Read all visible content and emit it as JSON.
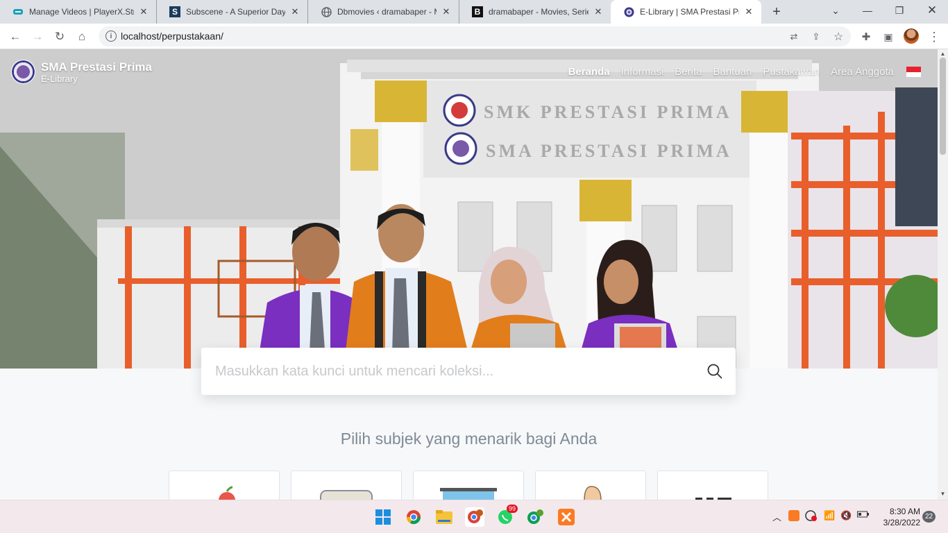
{
  "browser": {
    "tabs": [
      {
        "title": "Manage Videos | PlayerX.Stre",
        "icon": "playerx-favicon"
      },
      {
        "title": "Subscene - A Superior Day (U",
        "icon": "subscene-favicon"
      },
      {
        "title": "Dbmovies ‹ dramabaper - Mo",
        "icon": "globe-favicon"
      },
      {
        "title": "dramabaper - Movies, Series",
        "icon": "blogger-b-favicon"
      },
      {
        "title": "E-Library | SMA Prestasi Prim",
        "icon": "school-favicon",
        "active": true
      }
    ],
    "url": "localhost/perpustakaan/"
  },
  "site": {
    "brand_name": "SMA Prestasi Prima",
    "brand_sub": "E-Library",
    "nav": [
      "Beranda",
      "Informasi",
      "Berita",
      "Bantuan",
      "Pustakawan",
      "Area Anggota"
    ],
    "active_nav": "Beranda",
    "hero_sign_1": "SMK PRESTASI PRIMA",
    "hero_sign_2": "SMA PRESTASI PRIMA",
    "search_placeholder": "Masukkan kata kunci untuk mencari koleksi...",
    "subject_heading": "Pilih subjek yang menarik bagi Anda",
    "flag_colors": [
      "#e8212e",
      "#ffffff"
    ]
  },
  "taskbar": {
    "whatsapp_badge": "99",
    "time": "8:30 AM",
    "date": "3/28/2022",
    "notification_count": "22"
  }
}
